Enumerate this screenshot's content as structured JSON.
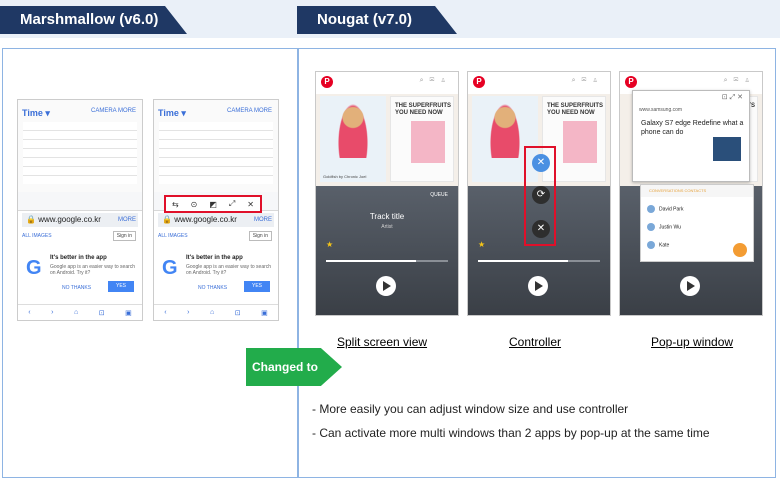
{
  "header": {
    "left_tab": "Marshmallow (v6.0)",
    "right_tab": "Nougat (v7.0)"
  },
  "marshmallow": {
    "time_label": "Time ▾",
    "camera_label": "CAMERA  MORE",
    "url": "www.google.co.kr",
    "url_more": "MORE",
    "subtabs": "ALL   IMAGES",
    "signin": "Sign in",
    "promo_title": "It's better in the app",
    "promo_body": "Google app is an easier way to search on Android. Try it?",
    "no_thanks": "NO THANKS",
    "yes": "YES",
    "nav_labels": [
      "‹",
      "›",
      "⌂",
      "⊡",
      "▣"
    ],
    "toolbar_icons": [
      "⇆",
      "⊙",
      "◩",
      "⤢",
      "✕"
    ]
  },
  "nougat": {
    "magazine_title": "THE SUPERFRUITS YOU NEED NOW",
    "caption": "Goldfish by Chronic Joel",
    "track_title": "Track title",
    "artist": "Artist",
    "queue": "QUEUE",
    "popup_url": "www.samsung.com",
    "popup_text": "Galaxy S7 edge Redefine what a phone can do",
    "contacts_header": "CONVERSATIONS      CONTACTS",
    "contacts": [
      "David Park",
      "Justin Wu",
      "Kate"
    ]
  },
  "labels": {
    "split": "Split screen view",
    "controller": "Controller",
    "popup": "Pop-up window",
    "changed_to": "Changed to"
  },
  "bullets": [
    "-   More easily you can adjust window size and use controller",
    "-   Can activate more multi windows than 2 apps by pop-up at the same time"
  ],
  "colors": {
    "header_tab": "#1f3864",
    "arrow": "#22ac4b",
    "highlight": "#e0102a",
    "panel_border": "#8eb4e3"
  }
}
